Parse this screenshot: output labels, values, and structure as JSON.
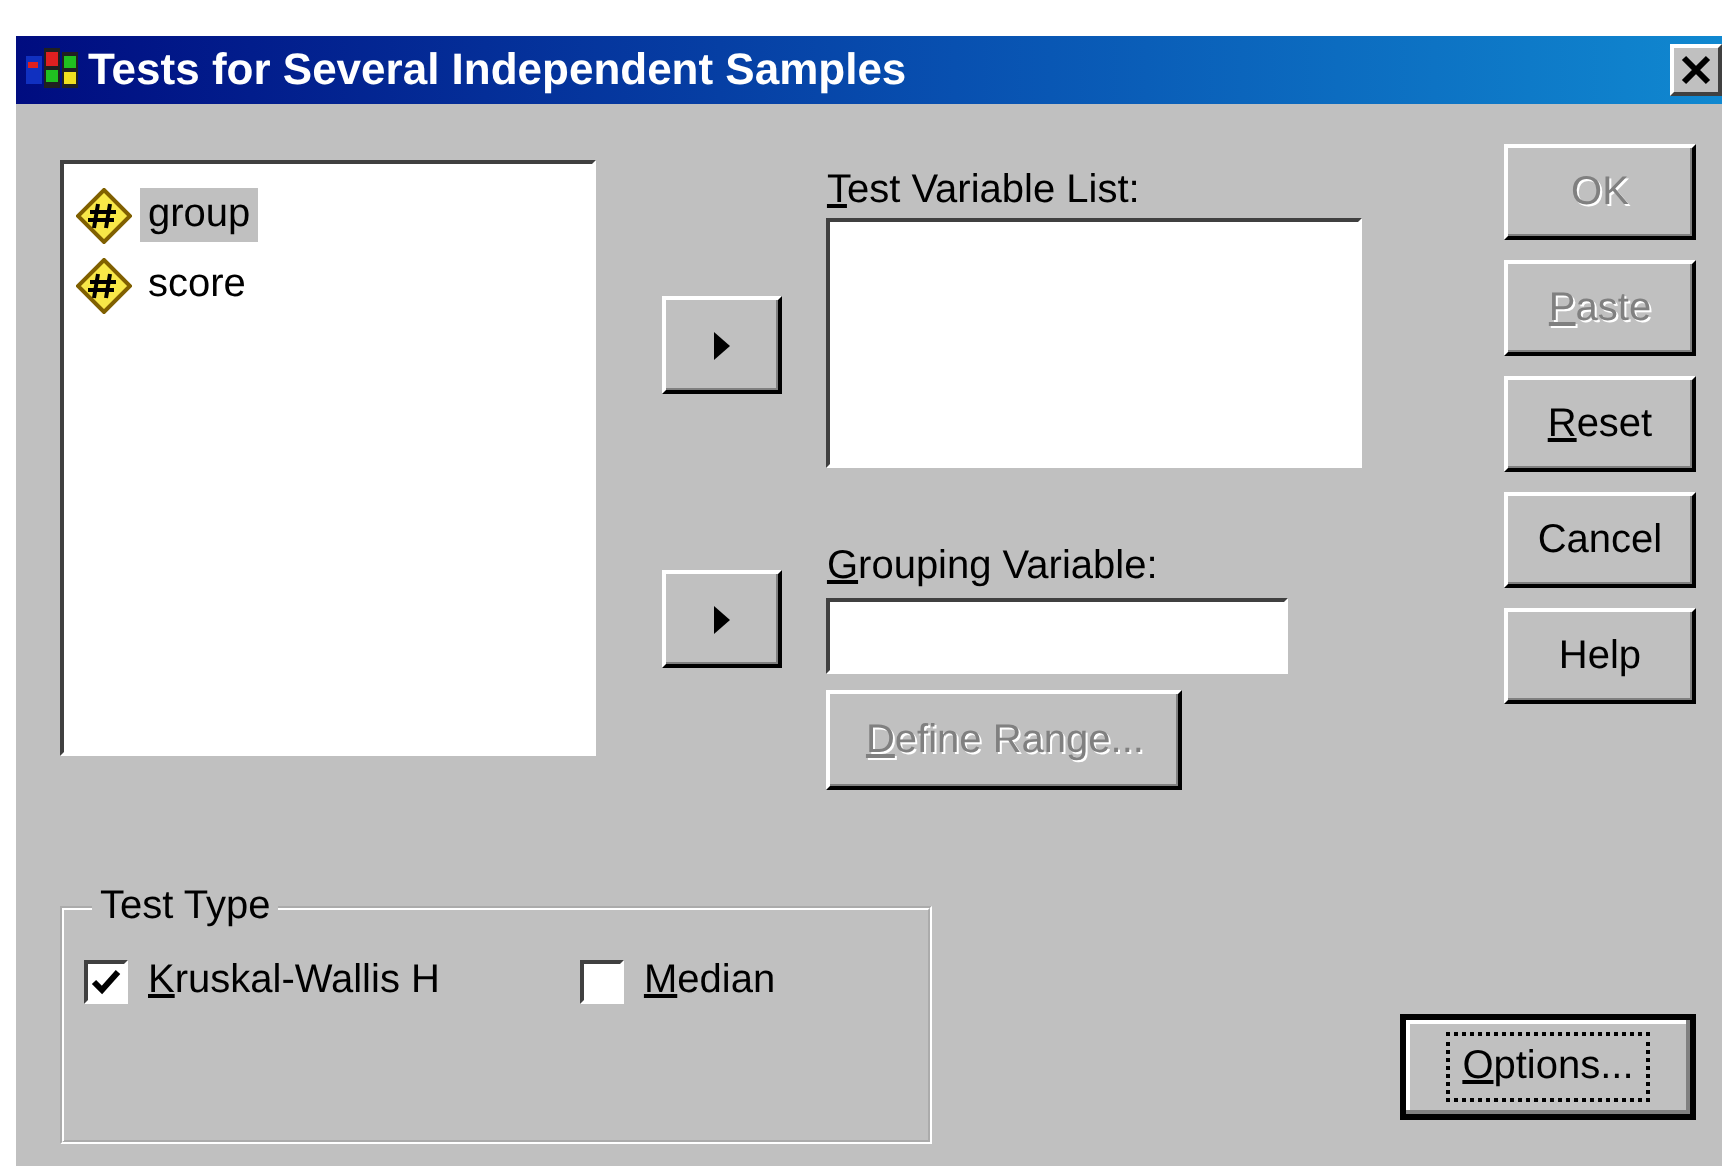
{
  "window": {
    "title": "Tests for Several Independent Samples"
  },
  "variables": [
    {
      "name": "group",
      "selected": true
    },
    {
      "name": "score",
      "selected": false
    }
  ],
  "test_variable_list": {
    "label_key": "T",
    "label_rest": "est Variable List:"
  },
  "grouping_variable": {
    "label_key": "G",
    "label_rest": "rouping Variable:"
  },
  "define_range": {
    "key": "D",
    "rest": "efine Range...",
    "disabled": true
  },
  "buttons": [
    {
      "rest": "OK",
      "disabled": true
    },
    {
      "key": "P",
      "rest": "aste",
      "disabled": true
    },
    {
      "key": "R",
      "rest": "eset",
      "disabled": false
    },
    {
      "rest": "Cancel",
      "disabled": false
    },
    {
      "rest": "Help",
      "disabled": false
    }
  ],
  "test_type": {
    "title": "Test Type",
    "options": [
      {
        "key": "K",
        "rest": "ruskal-Wallis H",
        "checked": true
      },
      {
        "key": "M",
        "rest": "edian",
        "checked": false
      }
    ]
  },
  "options_button": {
    "key": "O",
    "rest": "ptions...",
    "focused": true
  }
}
